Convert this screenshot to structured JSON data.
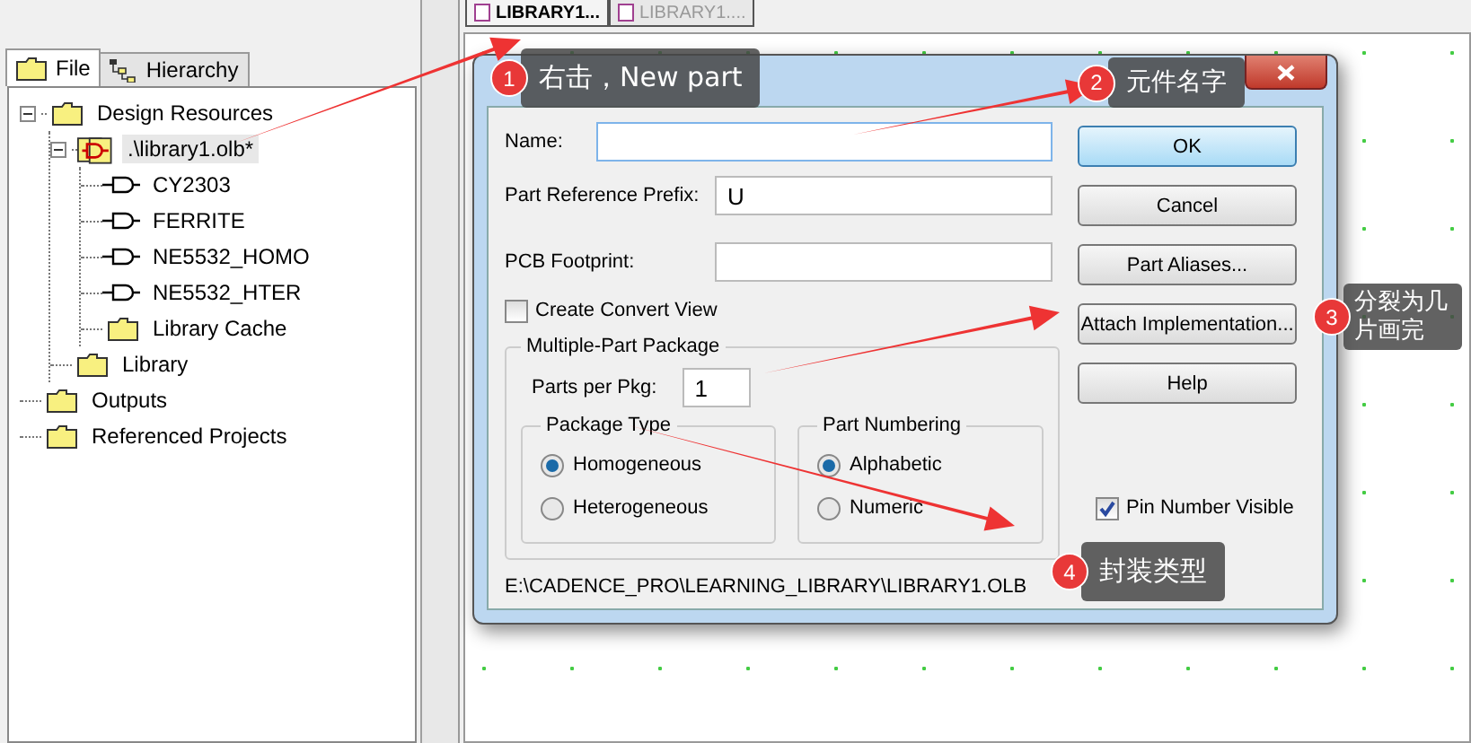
{
  "project_panel": {
    "tabs": [
      {
        "label": "File",
        "selected": true
      },
      {
        "label": "Hierarchy",
        "selected": false
      }
    ],
    "tree": [
      {
        "label": "Design Resources",
        "kind": "folder",
        "expanded": true,
        "selected": false,
        "children": [
          {
            "label": ".\\library1.olb*",
            "kind": "library",
            "expanded": true,
            "selected": true,
            "children": [
              {
                "label": "CY2303",
                "kind": "part",
                "selected": false
              },
              {
                "label": "FERRITE",
                "kind": "part",
                "selected": false
              },
              {
                "label": "NE5532_HOMO",
                "kind": "part",
                "selected": false
              },
              {
                "label": "NE5532_HTER",
                "kind": "part",
                "selected": false
              },
              {
                "label": "Library Cache",
                "kind": "folder",
                "selected": false
              }
            ]
          },
          {
            "label": "Library",
            "kind": "folder",
            "selected": false
          }
        ]
      },
      {
        "label": "Outputs",
        "kind": "folder",
        "selected": false
      },
      {
        "label": "Referenced Projects",
        "kind": "folder",
        "selected": false
      }
    ]
  },
  "document_tabs": [
    {
      "label": "LIBRARY1...",
      "selected": true
    },
    {
      "label": "LIBRARY1....",
      "selected": false
    }
  ],
  "dialog": {
    "fields": [
      {
        "label": "Name:"
      },
      {
        "label": "Part Reference Prefix:",
        "value": "U"
      },
      {
        "label": "PCB Footprint:"
      }
    ],
    "create_convert_view": {
      "label": "Create Convert View",
      "checked": false
    },
    "package_group": {
      "title": "Multiple-Part Package",
      "parts_per_pkg": {
        "label": "Parts per Pkg:",
        "value": "1"
      },
      "package_type": {
        "title": "Package Type",
        "options": [
          {
            "label": "Homogeneous",
            "selected": true
          },
          {
            "label": "Heterogeneous",
            "selected": false
          }
        ]
      },
      "part_numbering": {
        "title": "Part Numbering",
        "options": [
          {
            "label": "Alphabetic",
            "selected": true
          },
          {
            "label": "Numeric",
            "selected": false
          }
        ]
      }
    },
    "buttons": [
      {
        "label": "OK",
        "default": true
      },
      {
        "label": "Cancel",
        "default": false
      },
      {
        "label": "Part Aliases...",
        "default": false
      },
      {
        "label": "Attach Implementation...",
        "default": false
      },
      {
        "label": "Help",
        "default": false
      }
    ],
    "pin_number_visible": {
      "label": "Pin Number Visible",
      "checked": true
    },
    "path": "E:\\CADENCE_PRO\\LEARNING_LIBRARY\\LIBRARY1.OLB"
  },
  "annotations": [
    {
      "number": "1",
      "text": "右击，New part"
    },
    {
      "number": "2",
      "text": "元件名字"
    },
    {
      "number": "3",
      "text": "分裂为几片画完"
    },
    {
      "number": "4",
      "text": "封装类型"
    }
  ]
}
